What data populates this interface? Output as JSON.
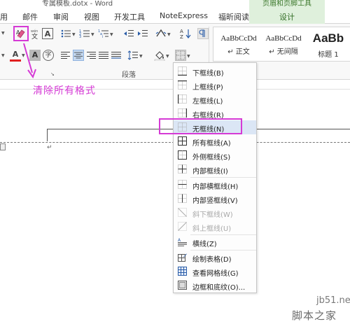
{
  "window": {
    "title": "专属模板.dotx - Word",
    "context_tool": "页眉和页脚工具"
  },
  "tabs": [
    {
      "label": "用"
    },
    {
      "label": "邮件"
    },
    {
      "label": "审阅"
    },
    {
      "label": "视图"
    },
    {
      "label": "开发工具"
    },
    {
      "label": "NoteExpress"
    },
    {
      "label": "福昕阅读器"
    },
    {
      "label": "设计"
    }
  ],
  "ribbon": {
    "paragraph_group_label": "段落",
    "styles": [
      {
        "sample": "AaBbCcDd",
        "name": "↵ 正文"
      },
      {
        "sample": "AaBbCcDd",
        "name": "↵ 无间隔"
      },
      {
        "sample": "AaBb",
        "name": "标题 1"
      }
    ],
    "icons": {
      "font_color_letter": "A",
      "shade_letter": "A",
      "char_border_letter": "A",
      "enclose_char": "字",
      "phonetic": "wén",
      "sort_label": "A↓Z"
    }
  },
  "annotation": {
    "text": "清除所有格式",
    "color": "#d53ad5"
  },
  "border_menu": {
    "items": [
      {
        "label": "下框线(B)",
        "icon": "bottom-border-icon",
        "enabled": true
      },
      {
        "label": "上框线(P)",
        "icon": "top-border-icon",
        "enabled": true
      },
      {
        "label": "左框线(L)",
        "icon": "left-border-icon",
        "enabled": true
      },
      {
        "label": "右框线(R)",
        "icon": "right-border-icon",
        "enabled": true
      },
      {
        "label": "无框线(N)",
        "icon": "no-border-icon",
        "enabled": true,
        "highlighted": true
      },
      {
        "label": "所有框线(A)",
        "icon": "all-borders-icon",
        "enabled": true
      },
      {
        "label": "外侧框线(S)",
        "icon": "outside-borders-icon",
        "enabled": true
      },
      {
        "label": "内部框线(I)",
        "icon": "inside-borders-icon",
        "enabled": true
      },
      {
        "label": "内部横框线(H)",
        "icon": "inside-horizontal-border-icon",
        "enabled": true
      },
      {
        "label": "内部竖框线(V)",
        "icon": "inside-vertical-border-icon",
        "enabled": true
      },
      {
        "label": "斜下框线(W)",
        "icon": "diagonal-down-border-icon",
        "enabled": false
      },
      {
        "label": "斜上框线(U)",
        "icon": "diagonal-up-border-icon",
        "enabled": false
      },
      {
        "label": "横线(Z)",
        "icon": "horizontal-line-icon",
        "enabled": true
      },
      {
        "label": "绘制表格(D)",
        "icon": "draw-table-icon",
        "enabled": true
      },
      {
        "label": "查看网格线(G)",
        "icon": "view-gridlines-icon",
        "enabled": true
      },
      {
        "label": "边框和底纹(O)...",
        "icon": "borders-shading-icon",
        "enabled": true
      }
    ]
  },
  "watermark": {
    "line1": "jb51.net",
    "line2": "脚本之家"
  },
  "colors": {
    "highlight": "#d53ad5",
    "context_tab_bg": "#dff0dc",
    "context_tab_text": "#2f6b22"
  }
}
